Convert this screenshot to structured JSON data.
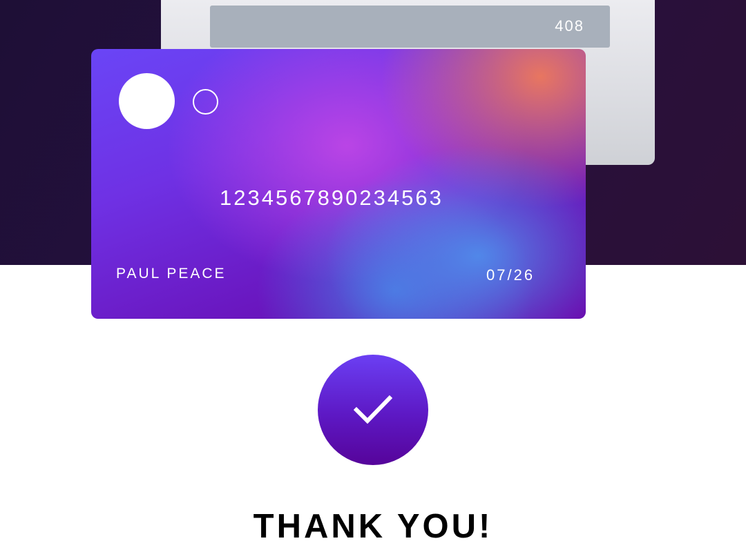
{
  "card": {
    "cvv": "408",
    "number": "1234567890234563",
    "holder": "PAUL PEACE",
    "expiry": "07/26"
  },
  "confirmation": {
    "icon": "checkmark-icon",
    "message": "THANK YOU!"
  },
  "colors": {
    "background_dark": "#23103c",
    "card_back": "#e2e3e8",
    "cvv_strip": "#a8b0bb",
    "card_primary": "#6a2ee0",
    "card_accent_orange": "#e8765f",
    "card_accent_blue": "#508ceb",
    "badge": "#5e1cc8",
    "text_dark": "#000000"
  }
}
